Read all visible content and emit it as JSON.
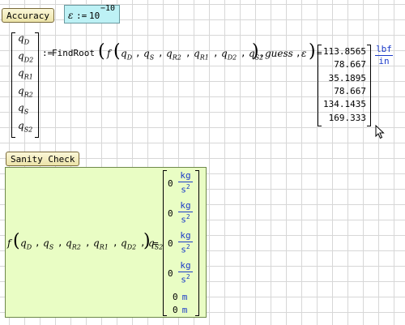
{
  "regions": {
    "accuracy_label": "Accuracy",
    "sanity_label": "Sanity Check"
  },
  "accuracy": {
    "symbol": "ε",
    "assign": ":=",
    "base": "10",
    "exponent": "−10"
  },
  "lhs_vector": [
    {
      "var": "q",
      "sub": "D"
    },
    {
      "var": "q",
      "sub": "D2"
    },
    {
      "var": "q",
      "sub": "R1"
    },
    {
      "var": "q",
      "sub": "R2"
    },
    {
      "var": "q",
      "sub": "S"
    },
    {
      "var": "q",
      "sub": "S2"
    }
  ],
  "findroot": {
    "assign": ":=",
    "func_name": "FindRoot",
    "inner_func": "f",
    "args": [
      "q_D",
      "q_S",
      "q_R2",
      "q_R1",
      "q_D2",
      "q_S2"
    ],
    "guess": "guess",
    "eps": "ε",
    "equals": "="
  },
  "results": [
    "113.8565",
    "78.667",
    "35.1895",
    "78.667",
    "134.1435",
    "169.333"
  ],
  "result_unit": {
    "num": "lbf",
    "den": "in"
  },
  "sanity": {
    "func": "f",
    "args": [
      "q_D",
      "q_S",
      "q_R2",
      "q_R1",
      "q_D2",
      "q_S2"
    ],
    "equals": "=",
    "rows": [
      {
        "value": "0",
        "unit_num": "kg",
        "unit_den": "s",
        "unit_den_exp": "2"
      },
      {
        "value": "0",
        "unit_num": "kg",
        "unit_den": "s",
        "unit_den_exp": "2"
      },
      {
        "value": "0",
        "unit_num": "kg",
        "unit_den": "s",
        "unit_den_exp": "2"
      },
      {
        "value": "0",
        "unit_num": "kg",
        "unit_den": "s",
        "unit_den_exp": "2"
      },
      {
        "value": "0",
        "unit": "m"
      },
      {
        "value": "0",
        "unit": "m"
      }
    ]
  },
  "cursor": "arrow-cursor-icon"
}
